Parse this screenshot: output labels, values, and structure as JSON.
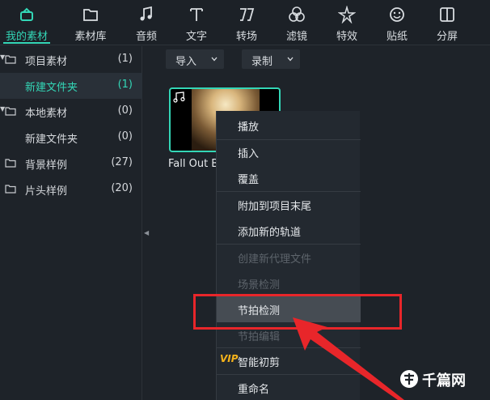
{
  "toolbar": {
    "items": [
      {
        "label": "我的素材",
        "icon": "media-box-icon",
        "active": true
      },
      {
        "label": "素材库",
        "icon": "folder-icon"
      },
      {
        "label": "音频",
        "icon": "music-note-icon"
      },
      {
        "label": "文字",
        "icon": "text-t-icon"
      },
      {
        "label": "转场",
        "icon": "transition-icon"
      },
      {
        "label": "滤镜",
        "icon": "filter-circles-icon"
      },
      {
        "label": "特效",
        "icon": "sparkle-star-icon"
      },
      {
        "label": "贴纸",
        "icon": "sticker-smile-icon"
      },
      {
        "label": "分屏",
        "icon": "split-screen-icon"
      }
    ]
  },
  "sidebar": {
    "folders": [
      {
        "label": "项目素材",
        "count": "(1)",
        "expanded": true
      },
      {
        "label": "新建文件夹",
        "count": "(1)",
        "selected": true
      },
      {
        "label": "本地素材",
        "count": "(0)",
        "expanded": true
      },
      {
        "label": "新建文件夹",
        "count": "(0)"
      },
      {
        "label": "背景样例",
        "count": "(27)"
      },
      {
        "label": "片头样例",
        "count": "(20)"
      }
    ]
  },
  "content": {
    "import_label": "导入",
    "record_label": "录制",
    "clip_title": "Fall Out B"
  },
  "context_menu": {
    "items": [
      {
        "label": "播放"
      },
      {
        "label": "插入"
      },
      {
        "label": "覆盖"
      },
      {
        "label": "附加到项目末尾"
      },
      {
        "label": "添加新的轨道"
      },
      {
        "label": "创建新代理文件",
        "disabled": true
      },
      {
        "label": "场景检测",
        "disabled": true
      },
      {
        "label": "节拍检测",
        "hover": true
      },
      {
        "label": "节拍编辑",
        "disabled": true
      },
      {
        "label": "智能初剪",
        "badge": "VIP"
      },
      {
        "label": "重命名"
      }
    ]
  },
  "watermark": {
    "label": "千篇网"
  },
  "colors": {
    "accent": "#33d6b6",
    "annotation": "#e8262a",
    "vip": "#f4b21b"
  }
}
